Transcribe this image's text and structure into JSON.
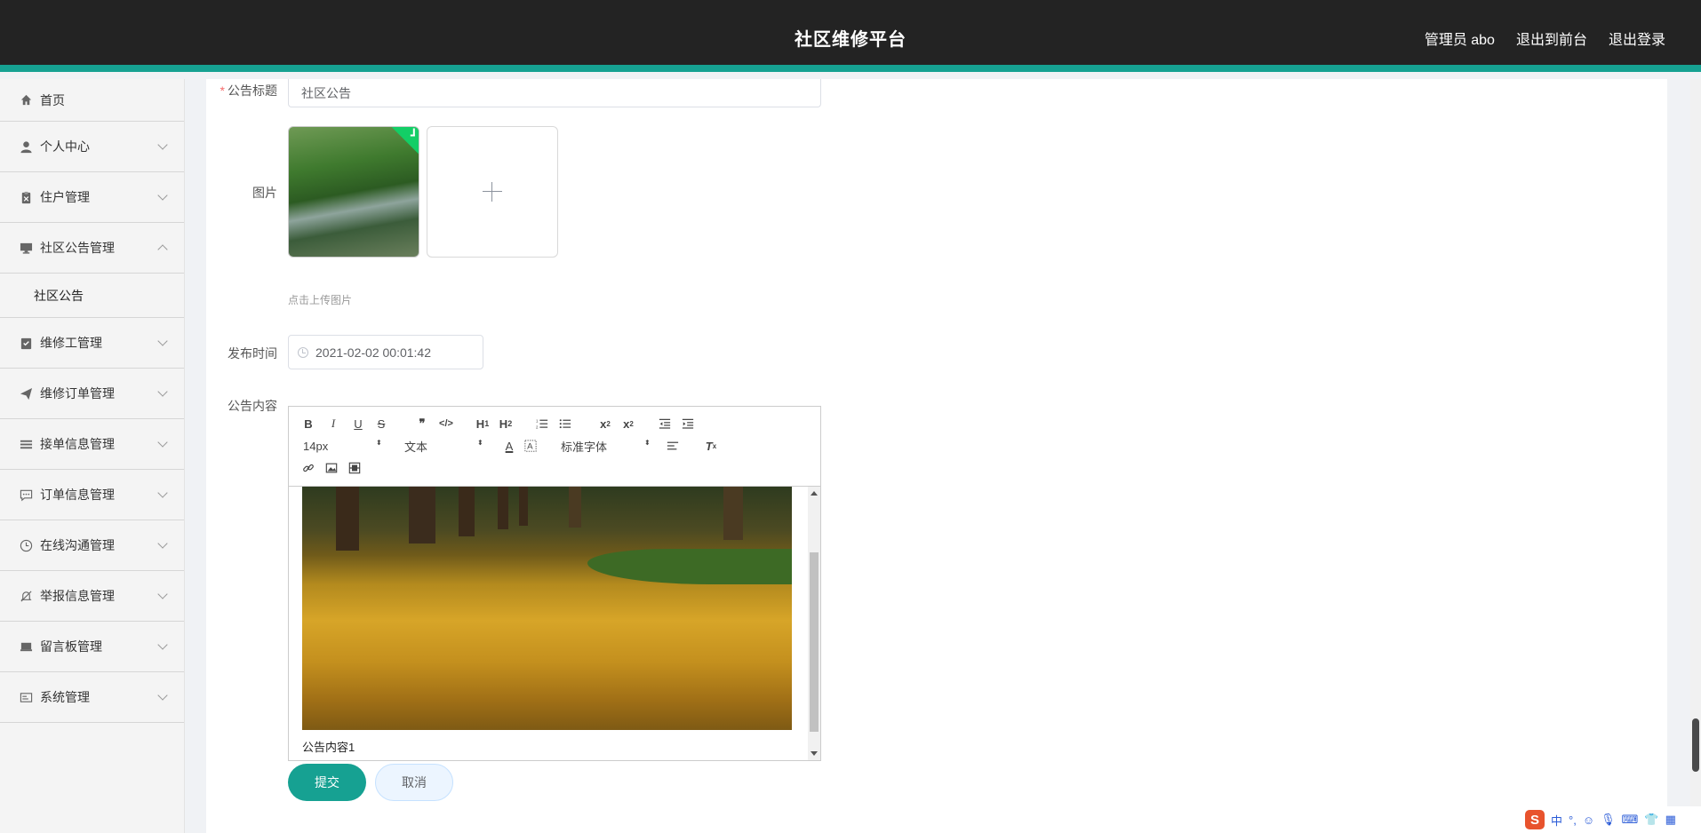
{
  "header": {
    "title": "社区维修平台",
    "admin_label": "管理员 abo",
    "to_front_label": "退出到前台",
    "logout_label": "退出登录"
  },
  "sidebar": {
    "items": [
      {
        "label": "首页",
        "icon": "home-icon"
      },
      {
        "label": "个人中心",
        "icon": "user-icon"
      },
      {
        "label": "住户管理",
        "icon": "clipboard-icon"
      },
      {
        "label": "社区公告管理",
        "icon": "monitor-icon",
        "expanded": true,
        "children": [
          "社区公告"
        ]
      },
      {
        "label": "维修工管理",
        "icon": "checklist-icon"
      },
      {
        "label": "维修订单管理",
        "icon": "send-icon"
      },
      {
        "label": "接单信息管理",
        "icon": "list-icon"
      },
      {
        "label": "订单信息管理",
        "icon": "chat-icon"
      },
      {
        "label": "在线沟通管理",
        "icon": "clock-icon"
      },
      {
        "label": "举报信息管理",
        "icon": "bell-off-icon"
      },
      {
        "label": "留言板管理",
        "icon": "board-icon"
      },
      {
        "label": "系统管理",
        "icon": "card-icon"
      }
    ]
  },
  "form": {
    "title_label": "公告标题",
    "title_required": "*",
    "title_value": "社区公告",
    "image_label": "图片",
    "upload_tip": "点击上传图片",
    "publish_time_label": "发布时间",
    "publish_time_value": "2021-02-02 00:01:42",
    "content_label": "公告内容",
    "content_text": "公告内容1",
    "editor": {
      "font_size": "14px",
      "header_select": "文本",
      "font_family": "标准字体"
    },
    "submit_label": "提交",
    "cancel_label": "取消"
  },
  "ime": {
    "lang": "中"
  },
  "colors": {
    "accent": "#16a192",
    "header_bg": "#232323"
  }
}
